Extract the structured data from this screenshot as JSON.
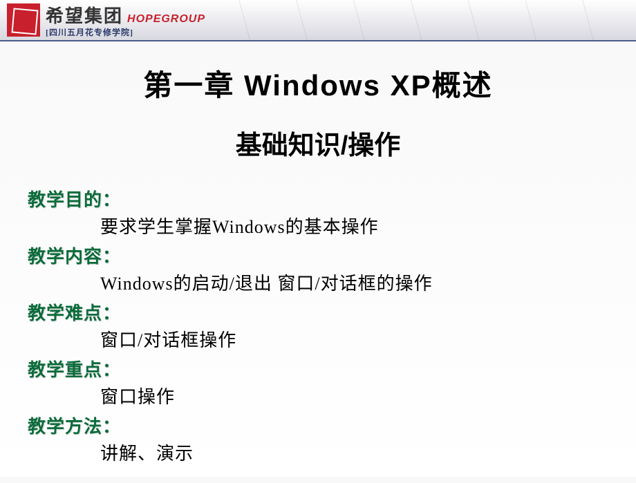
{
  "header": {
    "logo_cn": "希望集团",
    "logo_en": "HOPEGROUP",
    "logo_sub": "[四川五月花专修学院]"
  },
  "title": {
    "main": "第一章  Windows XP概述",
    "sub": "基础知识/操作"
  },
  "sections": [
    {
      "label": "教学目的：",
      "body": "要求学生掌握Windows的基本操作"
    },
    {
      "label": "教学内容：",
      "body": "Windows的启动/退出  窗口/对话框的操作"
    },
    {
      "label": "教学难点：",
      "body": "窗口/对话框操作"
    },
    {
      "label": "教学重点：",
      "body": "窗口操作"
    },
    {
      "label": "教学方法：",
      "body": "讲解、演示"
    }
  ]
}
